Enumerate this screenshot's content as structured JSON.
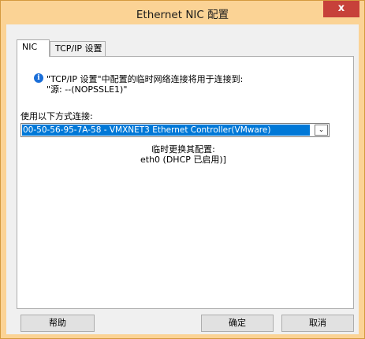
{
  "window": {
    "title": "Ethernet NIC 配置",
    "close_glyph": "x"
  },
  "tabs": [
    {
      "label": "NIC",
      "active": true
    },
    {
      "label": "TCP/IP 设置",
      "active": false
    }
  ],
  "info": {
    "icon": "info-icon",
    "line1": "\"TCP/IP 设置\"中配置的临时网络连接将用于连接到:",
    "line2": "\"源: --(NOPSSLE1)\""
  },
  "connection": {
    "label": "使用以下方式连接:",
    "selected_value": "00-50-56-95-7A-58 - VMXNET3 Ethernet Controller(VMware)"
  },
  "temp": {
    "label": "临时更换其配置:",
    "value": "eth0 (DHCP 已启用)]"
  },
  "buttons": {
    "help": "帮助",
    "ok": "确定",
    "cancel": "取消"
  },
  "colors": {
    "titlebar": "#fbd395",
    "close_button": "#c7413a",
    "selection": "#0078d7"
  }
}
